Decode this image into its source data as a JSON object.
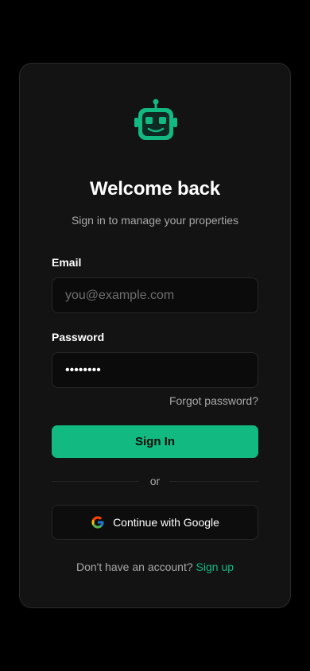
{
  "header": {
    "logo_icon": "robot-icon",
    "title": "Welcome back",
    "subtitle": "Sign in to manage your properties"
  },
  "form": {
    "email_label": "Email",
    "email_placeholder": "you@example.com",
    "email_value": "",
    "password_label": "Password",
    "password_value": "abcdefgh",
    "forgot_label": "Forgot password?",
    "submit_label": "Sign In"
  },
  "divider": {
    "label": "or"
  },
  "social": {
    "google_icon": "google-icon",
    "google_label": "Continue with Google"
  },
  "footer": {
    "prompt": "Don't have an account?",
    "signup_label": "Sign up"
  },
  "colors": {
    "accent": "#12b981",
    "background": "#000000",
    "card": "#131313"
  }
}
